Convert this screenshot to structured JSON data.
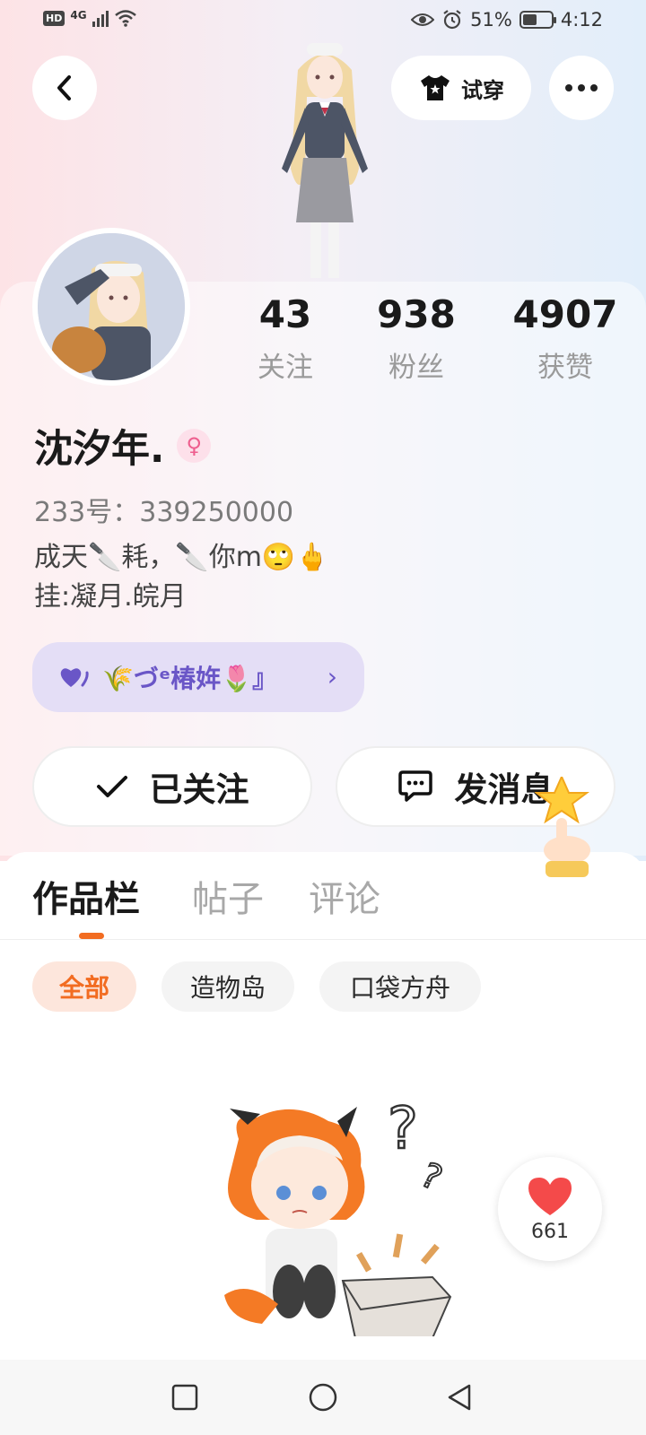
{
  "status_bar": {
    "hd": "HD",
    "network": "4G",
    "battery_percent": "51%",
    "battery_level": 0.51,
    "time": "4:12"
  },
  "header": {
    "try_on_label": "试穿"
  },
  "profile": {
    "stats": [
      {
        "value": "43",
        "label": "关注"
      },
      {
        "value": "938",
        "label": "粉丝"
      },
      {
        "value": "4907",
        "label": "获赞"
      }
    ],
    "name": "沈汐年.",
    "gender_symbol": "♀",
    "uid": "233号：339250000",
    "bio_line1": "成天🔪耗，🔪你m🙄🖕",
    "bio_line2": "挂:凝月.皖月",
    "tag_label": "🌾づᵉ椿姩🌷』"
  },
  "actions": {
    "follow_label": "已关注",
    "message_label": "发消息"
  },
  "tabs": [
    {
      "label": "作品栏",
      "active": true
    },
    {
      "label": "帖子",
      "active": false
    },
    {
      "label": "评论",
      "active": false
    }
  ],
  "filters": [
    {
      "label": "全部",
      "active": true
    },
    {
      "label": "造物岛",
      "active": false
    },
    {
      "label": "口袋方舟",
      "active": false
    }
  ],
  "like_float": {
    "count": "661"
  },
  "colors": {
    "accent": "#f26c21",
    "tag_bg": "#e4def6",
    "tag_text": "#6a56c7",
    "heart": "#f44a4a"
  },
  "icons": {
    "back": "chevron-left-icon",
    "try_on": "shirt-icon",
    "more": "more-dots-icon",
    "follow": "check-icon",
    "message": "chat-bubble-icon",
    "tag": "heart-icon",
    "like": "heart-icon",
    "nav": [
      "square-icon",
      "circle-icon",
      "triangle-back-icon"
    ]
  }
}
